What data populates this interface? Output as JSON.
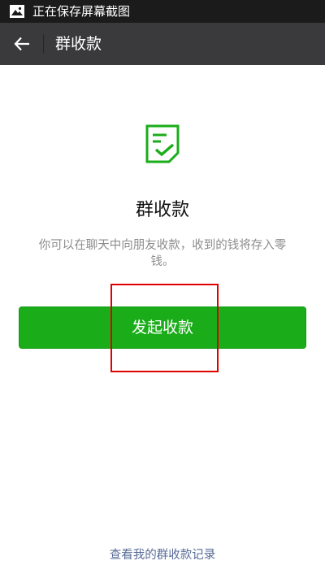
{
  "status_bar": {
    "icon": "image-icon",
    "text": "正在保存屏幕截图"
  },
  "header": {
    "back_icon": "back-arrow-icon",
    "title": "群收款"
  },
  "main": {
    "icon": "checklist-icon",
    "title": "群收款",
    "description": "你可以在聊天中向朋友收款，收到的钱将存入零钱。",
    "start_button_label": "发起收款",
    "records_link": "查看我的群收款记录"
  },
  "colors": {
    "accent": "#1aad19",
    "link": "#576b95",
    "header_bg": "#3a3a3c",
    "status_bg": "#1b1b1b",
    "highlight": "#e00000"
  }
}
